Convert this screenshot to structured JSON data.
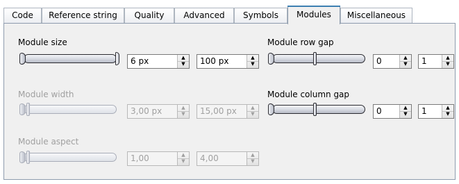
{
  "tabs": [
    {
      "label": "Code"
    },
    {
      "label": "Reference string"
    },
    {
      "label": "Quality"
    },
    {
      "label": "Advanced"
    },
    {
      "label": "Symbols"
    },
    {
      "label": "Modules"
    },
    {
      "label": "Miscellaneous"
    }
  ],
  "active_tab": "Modules",
  "module_size": {
    "label": "Module size",
    "slider_range": [
      0.0,
      1.0
    ],
    "min_value": "6 px",
    "max_value": "100 px",
    "enabled": true
  },
  "module_width": {
    "label": "Module width",
    "slider_range": [
      0.0,
      0.05
    ],
    "min_value": "3,00 px",
    "max_value": "15,00 px",
    "enabled": false
  },
  "module_aspect": {
    "label": "Module aspect",
    "slider_range": [
      0.0,
      0.05
    ],
    "min_value": "1,00",
    "max_value": "4,00",
    "enabled": false
  },
  "module_row_gap": {
    "label": "Module row gap",
    "slider_range": [
      0.0,
      0.45
    ],
    "min_value": "0",
    "max_value": "1",
    "enabled": true
  },
  "module_column_gap": {
    "label": "Module column gap",
    "slider_range": [
      0.0,
      0.45
    ],
    "min_value": "0",
    "max_value": "1",
    "enabled": true
  },
  "icons": {
    "spin_up": "▲",
    "spin_down": "▼"
  }
}
